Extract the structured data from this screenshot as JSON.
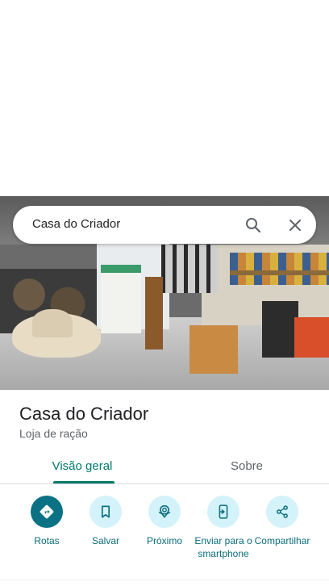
{
  "search": {
    "query": "Casa do Criador"
  },
  "place": {
    "name": "Casa do Criador",
    "category": "Loja de ração"
  },
  "tabs": {
    "overview": "Visão geral",
    "about": "Sobre",
    "selected": "Visão geral"
  },
  "actions": [
    {
      "label": "Rotas",
      "icon": "directions-icon"
    },
    {
      "label": "Salvar",
      "icon": "bookmark-icon"
    },
    {
      "label": "Próximo",
      "icon": "nearby-icon"
    },
    {
      "label": "Enviar para o smartphone",
      "icon": "send-to-phone-icon"
    },
    {
      "label": "Compartilhar",
      "icon": "share-icon"
    }
  ],
  "colors": {
    "accent": "#00796b",
    "action_primary": "#0b7285",
    "action_bg": "#d4f2fa",
    "action_label": "#0b6e7a"
  }
}
